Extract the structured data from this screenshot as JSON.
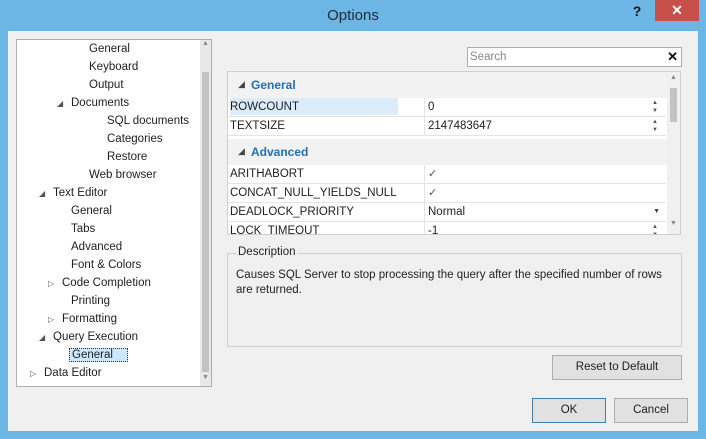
{
  "window": {
    "title": "Options",
    "help_glyph": "?",
    "close_glyph": "✕"
  },
  "tree": {
    "items": [
      {
        "label": "General",
        "indent": 2,
        "arrow": "",
        "selected": false
      },
      {
        "label": "Keyboard",
        "indent": 2,
        "arrow": "",
        "selected": false
      },
      {
        "label": "Output",
        "indent": 2,
        "arrow": "",
        "selected": false
      },
      {
        "label": "Documents",
        "indent": 1,
        "arrow": "◢",
        "selected": false
      },
      {
        "label": "SQL documents",
        "indent": 3,
        "arrow": "",
        "selected": false
      },
      {
        "label": "Categories",
        "indent": 3,
        "arrow": "",
        "selected": false
      },
      {
        "label": "Restore",
        "indent": 3,
        "arrow": "",
        "selected": false
      },
      {
        "label": "Web browser",
        "indent": 2,
        "arrow": "",
        "selected": false
      },
      {
        "label": "Text Editor",
        "indent": 0,
        "arrow": "◢",
        "selected": false
      },
      {
        "label": "General",
        "indent": 1,
        "arrow": "",
        "selected": false
      },
      {
        "label": "Tabs",
        "indent": 1,
        "arrow": "",
        "selected": false
      },
      {
        "label": "Advanced",
        "indent": 1,
        "arrow": "",
        "selected": false
      },
      {
        "label": "Font & Colors",
        "indent": 1,
        "arrow": "",
        "selected": false
      },
      {
        "label": "Code Completion",
        "indent": 0.5,
        "arrow": "▷",
        "selected": false
      },
      {
        "label": "Printing",
        "indent": 1,
        "arrow": "",
        "selected": false
      },
      {
        "label": "Formatting",
        "indent": 0.5,
        "arrow": "▷",
        "selected": false
      },
      {
        "label": "Query Execution",
        "indent": 0,
        "arrow": "◢",
        "selected": false
      },
      {
        "label": "General",
        "indent": 1,
        "arrow": "",
        "selected": true
      },
      {
        "label": "Data Editor",
        "indent": -0.5,
        "arrow": "▷",
        "selected": false
      }
    ]
  },
  "search": {
    "placeholder": "Search",
    "value": "",
    "clear_glyph": "✕"
  },
  "property_grid": {
    "categories": [
      {
        "label": "General",
        "arrow": "◢"
      },
      {
        "label": "Advanced",
        "arrow": "◢"
      }
    ],
    "general_rows": [
      {
        "name": "ROWCOUNT",
        "value": "0",
        "editor": "spin"
      },
      {
        "name": "TEXTSIZE",
        "value": "2147483647",
        "editor": "spin"
      }
    ],
    "advanced_rows": [
      {
        "name": "ARITHABORT",
        "value": "✓",
        "editor": "check"
      },
      {
        "name": "CONCAT_NULL_YIELDS_NULL",
        "value": "✓",
        "editor": "check"
      },
      {
        "name": "DEADLOCK_PRIORITY",
        "value": "Normal",
        "editor": "dropdown"
      },
      {
        "name": "LOCK_TIMEOUT",
        "value": "-1",
        "editor": "spin"
      }
    ]
  },
  "description": {
    "legend": "Description",
    "text": "Causes SQL Server to stop processing the query after the specified number of rows are returned."
  },
  "buttons": {
    "reset": "Reset to Default",
    "ok": "OK",
    "cancel": "Cancel"
  }
}
